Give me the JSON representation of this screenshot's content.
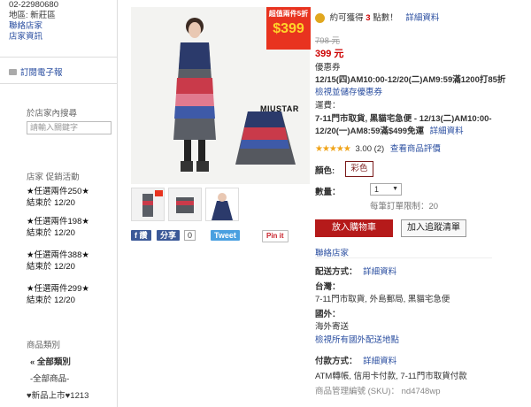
{
  "sidebar": {
    "phone": "02-22980680",
    "address": "地區: 新莊區",
    "link_store": "聯絡店家",
    "link_info": "店家資訊",
    "newsletter": "訂閱電子報",
    "search_title": "於店家內搜尋",
    "search_placeholder": "請輸入關鍵字",
    "promo_title": "店家 促銷活動",
    "promos": [
      {
        "name": "★任選兩件250★",
        "end": "結束於 12/20"
      },
      {
        "name": "★任選兩件198★",
        "end": "結束於 12/20"
      },
      {
        "name": "★任選兩件388★",
        "end": "結束於 12/20"
      },
      {
        "name": "★任選兩件299★",
        "end": "結束於 12/20"
      }
    ],
    "category_title": "商品類別",
    "categories": [
      "« 全部類別",
      "-全部商品-",
      "♥新品上市♥1213"
    ]
  },
  "product": {
    "badge_top": "超值兩件5折",
    "badge_price": "$399",
    "brand": "MIUSTAR",
    "share_fb": "f 讚",
    "share_label": "分享",
    "share_count": "0",
    "tweet": "Tweet",
    "pin": "Pin it"
  },
  "details": {
    "points_text_pre": "約可獲得",
    "points_value": "3",
    "points_text_post": "點數！",
    "points_link": "詳細資料",
    "original_price": "798 元",
    "price": "399 元",
    "coupon_label": "優惠券",
    "coupon_text": "12/15(四)AM10:00-12/20(二)AM9:59滿1200打85折",
    "coupon_link": "檢視並儲存優惠券",
    "shipping_label": "運費：",
    "shipping_line1": "7-11門市取貨, 黑貓宅急便 - 12/13(二)AM10:00-",
    "shipping_line2_pre": "12/20(一)AM8:59滿$499免運",
    "shipping_link": "詳細資料",
    "rating_value": "3.00 (2)",
    "rating_stars": 3,
    "rating_link": "查看商品評價",
    "color_label": "顏色:",
    "color_option": "彩色",
    "qty_label": "數量：",
    "qty_value": "1",
    "qty_limit": "每筆訂單限制：20",
    "add_cart": "放入購物車",
    "add_track": "加入追蹤清單",
    "contact_store": "聯絡店家",
    "delivery_label": "配送方式：",
    "delivery_link": "詳細資料",
    "taiwan_label": "台灣：",
    "taiwan_text": "7-11門市取貨, 外島郵局, 黑貓宅急便",
    "overseas_label": "國外：",
    "overseas_text": "海外寄送",
    "overseas_link": "檢視所有國外配送地點",
    "payment_label": "付款方式：",
    "payment_link": "詳細資料",
    "payment_text": "ATM轉帳, 信用卡付款, 7-11門市取貨付款",
    "sku_text": "商品管理編號 (SKU)： nd4748wp"
  }
}
